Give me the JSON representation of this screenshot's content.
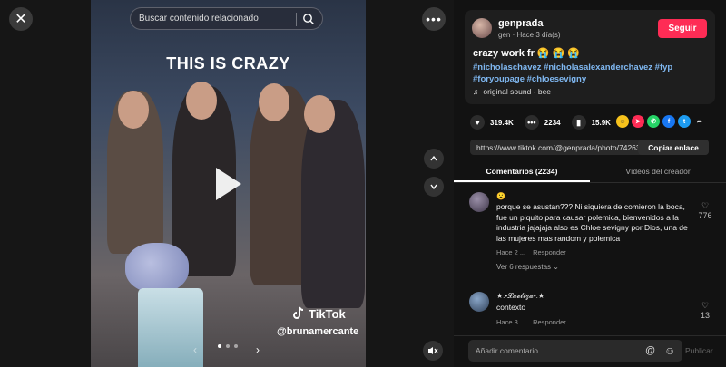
{
  "stage": {
    "close_icon": "close-icon",
    "more_icon": "more-horizontal-icon",
    "search": {
      "placeholder": "Buscar contenido relacionado"
    },
    "overlay_text": "THIS IS CRAZY",
    "watermark": "TikTok",
    "watermark_handle": "@brunamercante",
    "nav_up_icon": "chevron-up-icon",
    "nav_down_icon": "chevron-down-icon",
    "mute_icon": "mute-icon"
  },
  "author": {
    "name": "genprada",
    "meta": "gen · Hace 3 día(s)",
    "follow_label": "Seguir"
  },
  "post": {
    "caption": "crazy work fr 😭 😭 😭",
    "hashtags": "#nicholaschavez #nicholasalexanderchavez #fyp #foryoupage #chloesevigny",
    "sound": "original sound - bee"
  },
  "stats": {
    "likes": "319.4K",
    "comments": "2234",
    "saves": "15.9K"
  },
  "link": {
    "url": "https://www.tiktok.com/@genprada/photo/74263...",
    "copy_label": "Copiar enlace"
  },
  "tabs": [
    {
      "label": "Comentarios (2234)"
    },
    {
      "label": "Vídeos del creador"
    }
  ],
  "comments": [
    {
      "name": "😮",
      "text": "porque se asustan??? Ni siquiera de comieron la boca, fue un piquito para causar polemica, bienvenidos a la industria jajajaja also es Chloe sevigny por Dios, una de las mujeres mas random y polemica",
      "time": "Hace 2 ...",
      "reply_label": "Responder",
      "replies_label": "Ver 6 respuestas ⌄",
      "likes": "776"
    },
    {
      "name": "★.•𝓛𝓪𝓮𝓵𝓲𝔃𝓪•.★",
      "text": "contexto",
      "time": "Hace 3 ...",
      "reply_label": "Responder",
      "likes": "13"
    }
  ],
  "composer": {
    "placeholder": "Añadir comentario...",
    "mention_icon": "at-icon",
    "emoji_icon": "emoji-icon",
    "publish_label": "Publicar"
  }
}
